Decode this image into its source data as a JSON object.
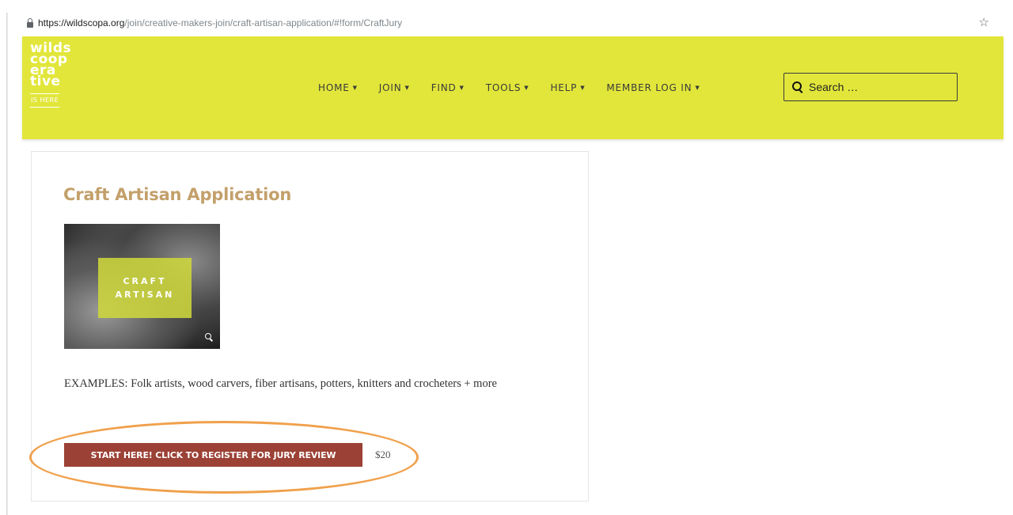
{
  "browser": {
    "url_host": "https://wildscopa.org",
    "url_path": "/join/creative-makers-join/craft-artisan-application/#!form/CraftJury"
  },
  "logo": {
    "line1": "wilds",
    "line2": "coop",
    "line3": "era",
    "line4": "tive",
    "tagline": "IS HERE"
  },
  "nav": {
    "items": [
      {
        "label": "HOME"
      },
      {
        "label": "JOIN"
      },
      {
        "label": "FIND"
      },
      {
        "label": "TOOLS"
      },
      {
        "label": "HELP"
      },
      {
        "label": "MEMBER LOG IN"
      }
    ],
    "caret": "▼"
  },
  "search": {
    "placeholder": "Search …"
  },
  "product": {
    "title": "Craft Artisan Application",
    "image_text_1": "CRAFT",
    "image_text_2": "ARTISAN",
    "description": "EXAMPLES: Folk artists, wood carvers, fiber artisans, potters, knitters and crocheters + more",
    "button_label": "START HERE! CLICK TO REGISTER FOR JURY REVIEW",
    "price": "$20"
  },
  "colors": {
    "header_bg": "#e2e63a",
    "title_color": "#c3a06b",
    "button_bg": "#9b4135",
    "annotation": "#f0a04b"
  }
}
